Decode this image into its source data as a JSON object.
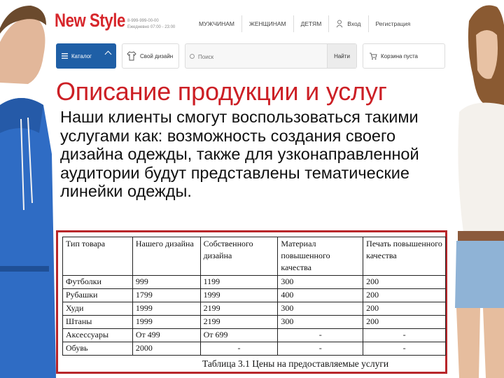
{
  "site": {
    "logo": "New Style",
    "contacts": [
      "8-999-999-00-00",
      "Ежедневно 07:00 - 23:00"
    ],
    "nav": [
      "МУЖЧИНАМ",
      "ЖЕНЩИНАМ",
      "ДЕТЯМ",
      "Вход",
      "Регистрация"
    ],
    "catalog_label": "Каталог",
    "design_label": "Свой дизайн",
    "search_placeholder": "Поиск",
    "search_button": "Найти",
    "cart_label": "Корзина пуста",
    "accent": "#1f5fa6",
    "brand": "#d7262b"
  },
  "slide": {
    "title": "Описание продукции и услуг",
    "body": "Наши клиенты смогут воспользоваться такими услугами как: возможность создания своего дизайна одежды, также для узконаправленной аудитории будут представлены тематические линейки одежды.",
    "title_color": "#cc1f25"
  },
  "table": {
    "headers": [
      "Тип товара",
      "Нашего дизайна",
      "Собственного дизайна",
      "Материал повышенного качества",
      "Печать повышенного качества"
    ],
    "rows": [
      [
        "Футболки",
        "999",
        "1199",
        "300",
        "200"
      ],
      [
        "Рубашки",
        "1799",
        "1999",
        "400",
        "200"
      ],
      [
        "Худи",
        "1999",
        "2199",
        "300",
        "200"
      ],
      [
        "Штаны",
        "1999",
        "2199",
        "300",
        "200"
      ],
      [
        "Аксессуары",
        "От 499",
        "От 699",
        "-",
        "-"
      ],
      [
        "Обувь",
        "2000",
        "-",
        "-",
        "-"
      ]
    ],
    "caption": "Таблица 3.1 Цены на предоставляемые услуги",
    "frame_color": "#b8262a"
  }
}
